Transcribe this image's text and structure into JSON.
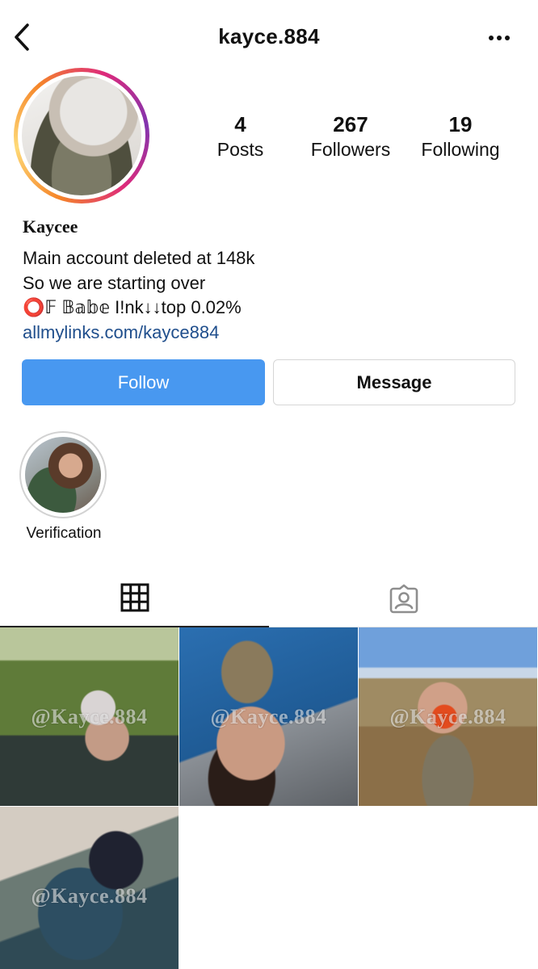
{
  "header": {
    "username": "kayce.884",
    "back_icon": "chevron-left-icon",
    "more_icon": "more-horizontal-icon"
  },
  "profile": {
    "avatar_icon": "profile-avatar-story-ring",
    "stats": {
      "posts": {
        "value": "4",
        "label": "Posts"
      },
      "followers": {
        "value": "267",
        "label": "Followers"
      },
      "following": {
        "value": "19",
        "label": "Following"
      }
    },
    "display_name": "Kaycee",
    "bio_lines": [
      "Main account deleted at 148k",
      "So we are starting over",
      "⭕️𝔽 𝔹𝕒𝕓𝕖 I!nk↓↓top 0.02%"
    ],
    "link": "allmylinks.com/kayce884"
  },
  "actions": {
    "follow_label": "Follow",
    "message_label": "Message"
  },
  "highlights": [
    {
      "label": "Verification"
    }
  ],
  "tabs": [
    {
      "icon": "grid-icon",
      "active": true
    },
    {
      "icon": "tagged-icon",
      "active": false
    }
  ],
  "posts": [
    {
      "watermark": "@Kayce.884"
    },
    {
      "watermark": "@Kayce.884"
    },
    {
      "watermark": "@Kayce.884"
    },
    {
      "watermark": "@Kayce.884"
    }
  ],
  "colors": {
    "follow_button": "#4898f0",
    "link": "#1f4e8c",
    "active_tab_indicator": "#222222"
  }
}
